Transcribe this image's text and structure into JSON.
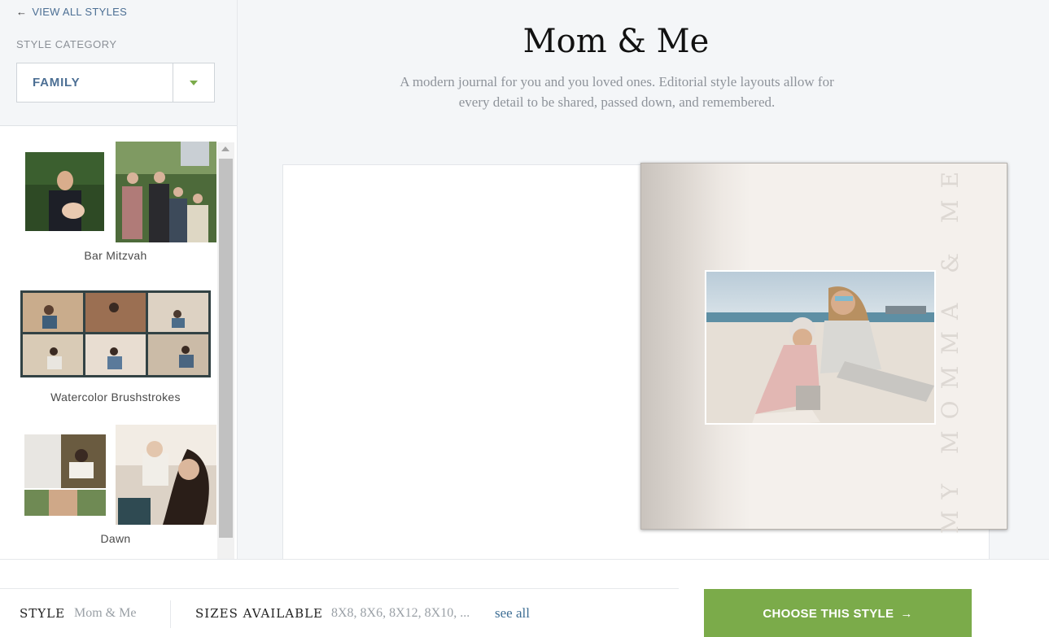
{
  "sidebar": {
    "back_arrow": "←",
    "back_label": "VIEW ALL STYLES",
    "category_label": "STYLE CATEGORY",
    "category_value": "FAMILY",
    "styles": [
      {
        "name": "Bar Mitzvah"
      },
      {
        "name": "Watercolor Brushstrokes"
      },
      {
        "name": "Dawn"
      }
    ]
  },
  "main": {
    "title": "Mom & Me",
    "description": "A modern journal for you and you loved ones. Editorial style layouts allow for every detail to be shared, passed down, and remembered.",
    "cover_text": "MY MOMMA & ME"
  },
  "footer": {
    "style_label": "STYLE",
    "style_value": "Mom & Me",
    "sizes_label": "SIZES AVAILABLE",
    "sizes_value": "8X8, 8X6, 8X12, 8X10, ...",
    "see_all": "see all",
    "choose_label": "CHOOSE THIS STYLE",
    "choose_arrow": "→"
  },
  "colors": {
    "accent_green": "#7bab4a",
    "link_blue": "#4c6f94",
    "panel_bg": "#f4f6f8"
  }
}
